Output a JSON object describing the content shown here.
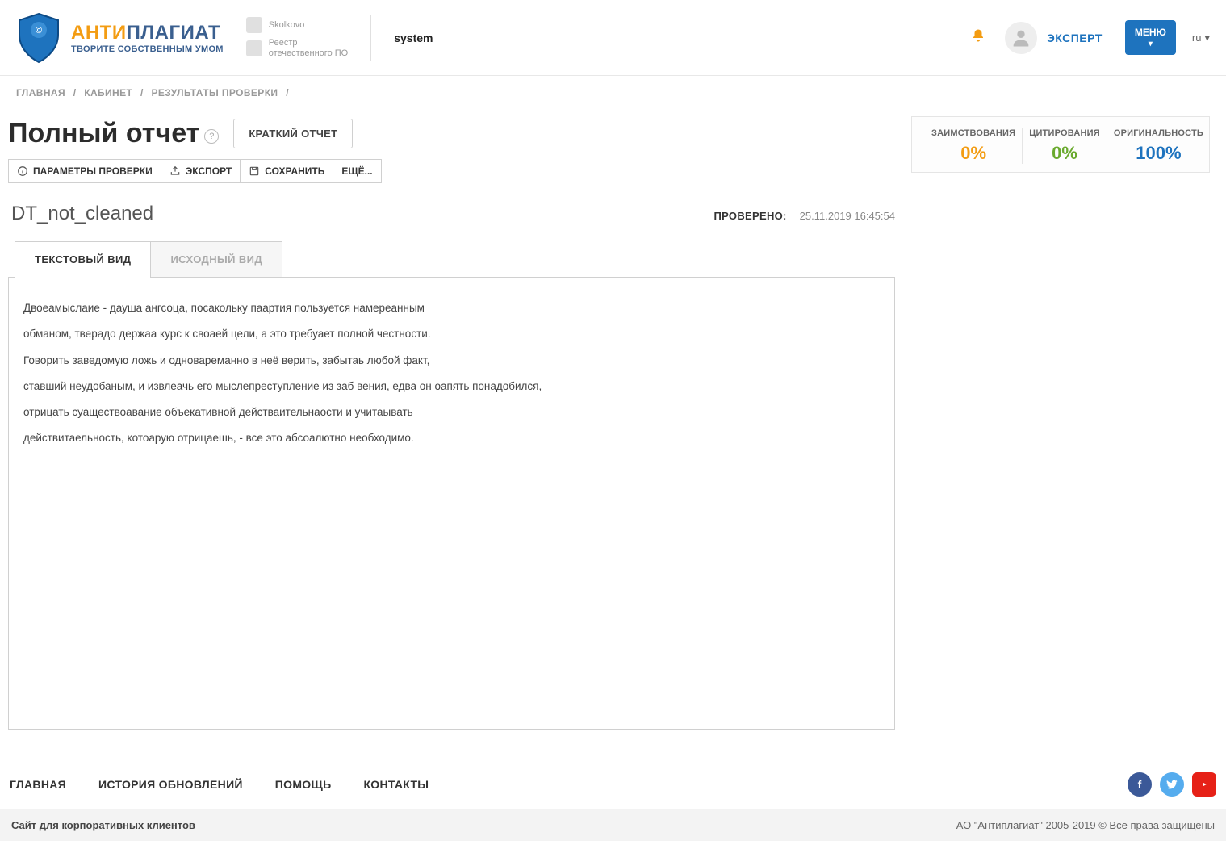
{
  "brand": {
    "anti": "АНТИ",
    "plagiat": "ПЛАГИАТ",
    "tagline": "ТВОРИТЕ СОБСТВЕННЫМ УМОМ"
  },
  "partners": {
    "sk": "Skolkovo",
    "registry_l1": "Реестр",
    "registry_l2": "отечественного ПО"
  },
  "header": {
    "system": "system",
    "role": "ЭКСПЕРТ",
    "menu": "МЕНЮ",
    "lang": "ru"
  },
  "breadcrumbs": {
    "home": "ГЛАВНАЯ",
    "cabinet": "КАБИНЕТ",
    "results": "РЕЗУЛЬТАТЫ ПРОВЕРКИ"
  },
  "title": "Полный отчет",
  "brief_report": "КРАТКИЙ ОТЧЕТ",
  "toolbar": {
    "params": "ПАРАМЕТРЫ ПРОВЕРКИ",
    "export": "ЭКСПОРТ",
    "save": "СОХРАНИТЬ",
    "more": "ЕЩЁ..."
  },
  "document": {
    "name": "DT_not_cleaned",
    "checked_label": "ПРОВЕРЕНО:",
    "checked_at": "25.11.2019 16:45:54"
  },
  "tabs": {
    "text": "ТЕКСТОВЫЙ ВИД",
    "source": "ИСХОДНЫЙ ВИД"
  },
  "body": {
    "p0": "Двоеамыслаие - дауша ангсоца, посакольку паартия пользуется намереанным",
    "p1": "обманом, тверадо держаа курс к своаей цели, а это требуает полной честности.",
    "p2": "Говорить заведомую ложь и одновареманно в неё верить, забытаь любой факт,",
    "p3": "ставший неудобаным, и извлеачь его мыслепреступление из заб вения, едва он оапять понадобился,",
    "p4": "отрицать суаществоавание объекативной действаительнаости и учитаывать",
    "p5": "действитаельность, котоарую отрицаешь, - все это абсоалютно необходимо."
  },
  "stats": {
    "borrow_label": "ЗАИМСТВОВАНИЯ",
    "borrow_value": "0%",
    "cite_label": "ЦИТИРОВАНИЯ",
    "cite_value": "0%",
    "orig_label": "ОРИГИНАЛЬНОСТЬ",
    "orig_value": "100%"
  },
  "footer": {
    "home": "ГЛАВНАЯ",
    "history": "ИСТОРИЯ ОБНОВЛЕНИЙ",
    "help": "ПОМОЩЬ",
    "contacts": "КОНТАКТЫ",
    "corp": "Сайт для корпоративных клиентов",
    "copyright": "АО \"Антиплагиат\" 2005-2019 © Все права защищены"
  }
}
